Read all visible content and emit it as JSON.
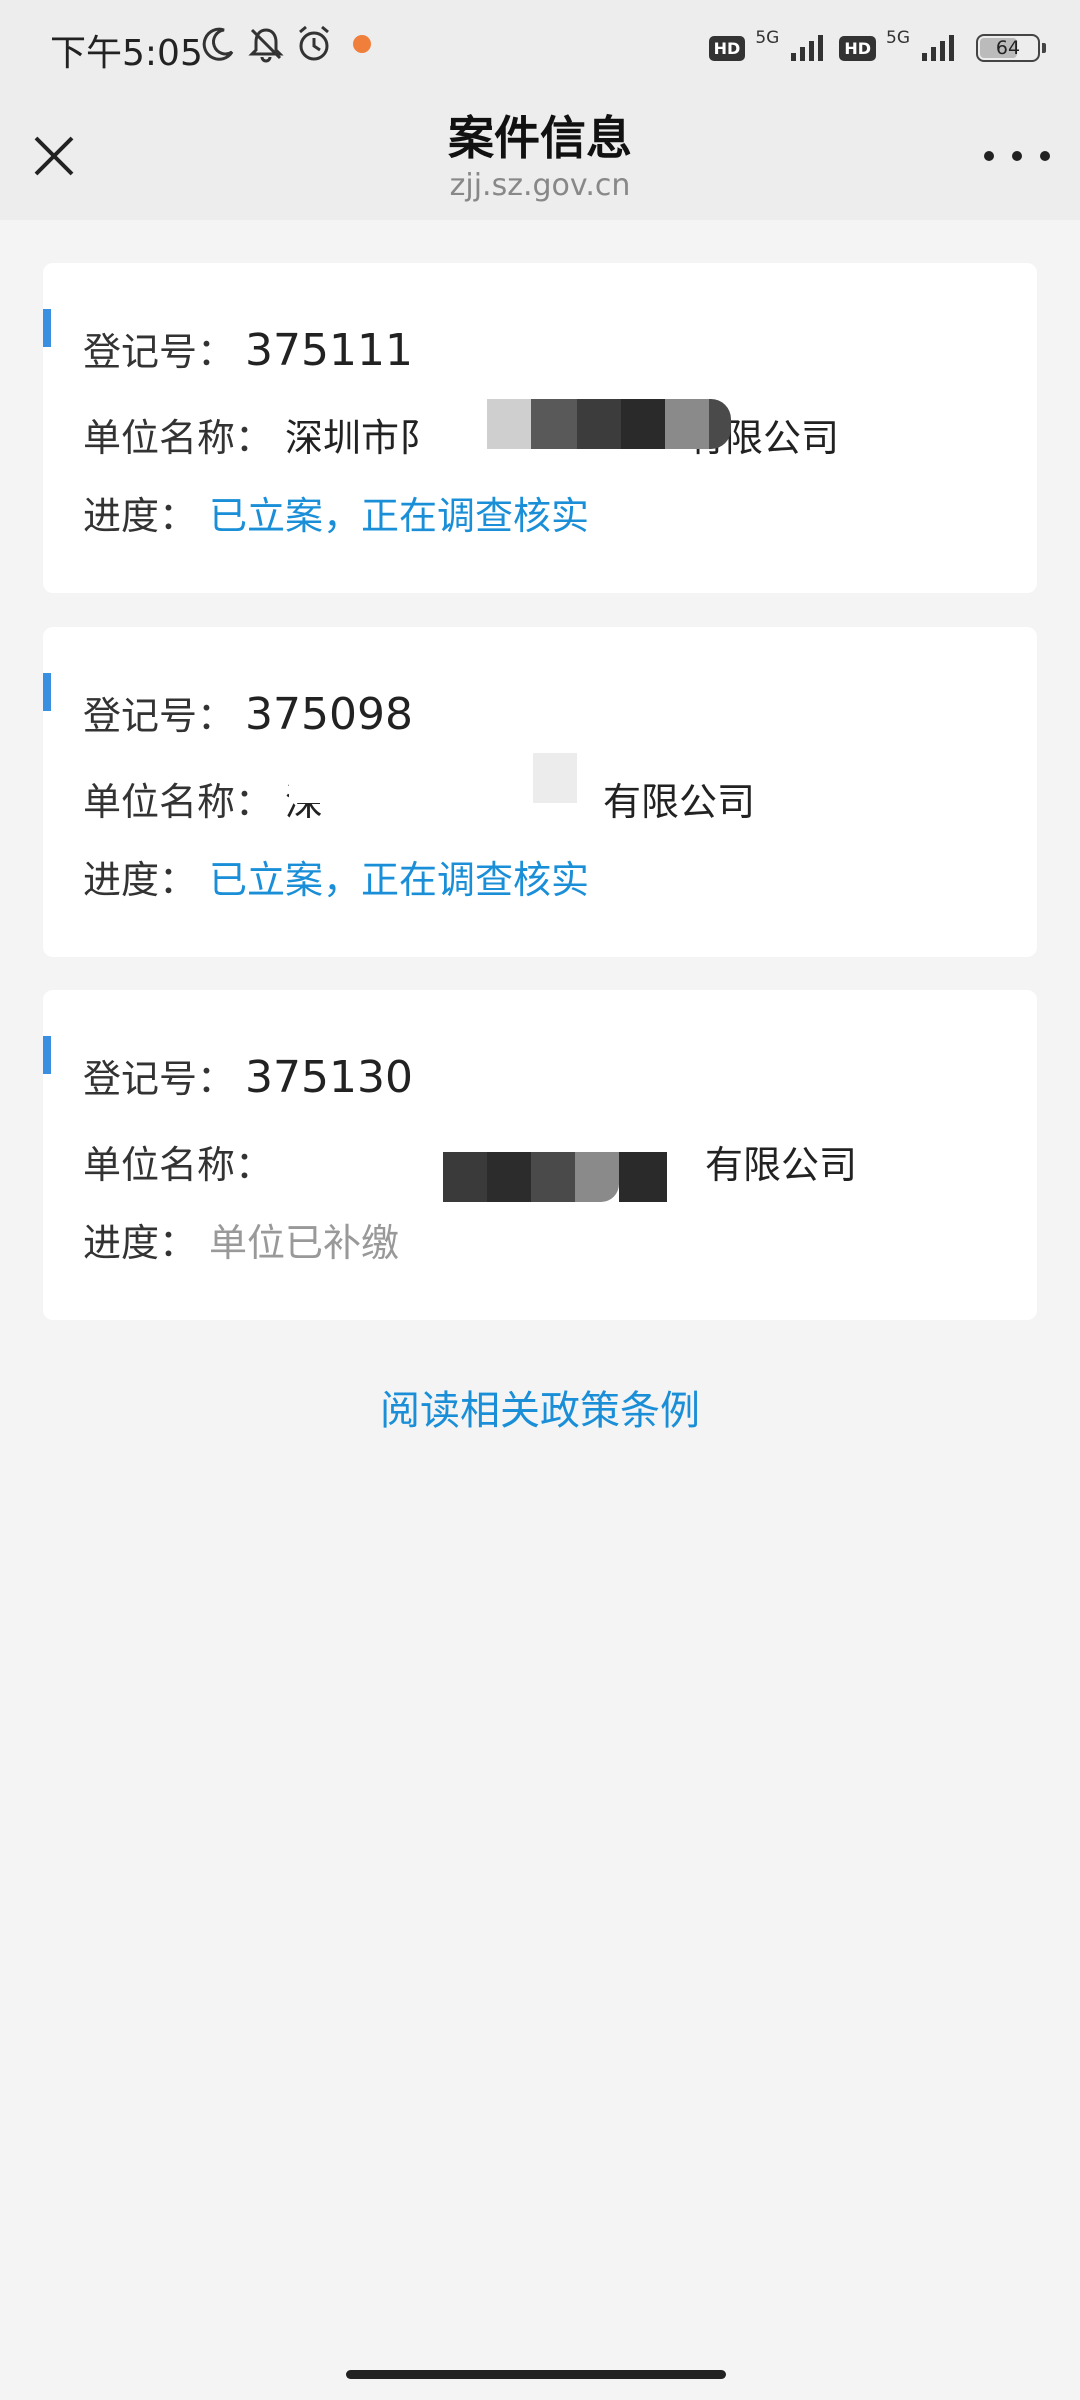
{
  "status_bar": {
    "time": "下午5:05",
    "icons": [
      "moon-icon",
      "bell-off-icon",
      "alarm-icon",
      "app-notification-icon"
    ],
    "hd1": "HD",
    "net1": "5G",
    "hd2": "HD",
    "net2": "5G",
    "battery": "64"
  },
  "header": {
    "title": "案件信息",
    "subtitle": "zjj.sz.gov.cn",
    "close_icon": "close-icon",
    "more_icon": "more-icon"
  },
  "cases": [
    {
      "reg_label": "登记号：",
      "reg_no": "375111",
      "unit_label": "单位名称：",
      "unit_prefix": "深圳市阝",
      "unit_suffix": "有限公司",
      "progress_label": "进度：",
      "progress": "已立案，正在调查核实",
      "progress_color": "#1a8fd8"
    },
    {
      "reg_label": "登记号：",
      "reg_no": "375098",
      "unit_label": "单位名称：",
      "unit_prefix": "深",
      "unit_suffix": "有限公司",
      "progress_label": "进度：",
      "progress": "已立案，正在调查核实",
      "progress_color": "#1a8fd8"
    },
    {
      "reg_label": "登记号：",
      "reg_no": "375130",
      "unit_label": "单位名称：",
      "unit_prefix": "",
      "unit_suffix": "有限公司",
      "progress_label": "进度：",
      "progress": "单位已补缴",
      "progress_color": "#999999"
    }
  ],
  "policy_link": "阅读相关政策条例",
  "colors": {
    "accent": "#3b8fe0",
    "link": "#1a8fd8",
    "background": "#f4f4f4"
  }
}
